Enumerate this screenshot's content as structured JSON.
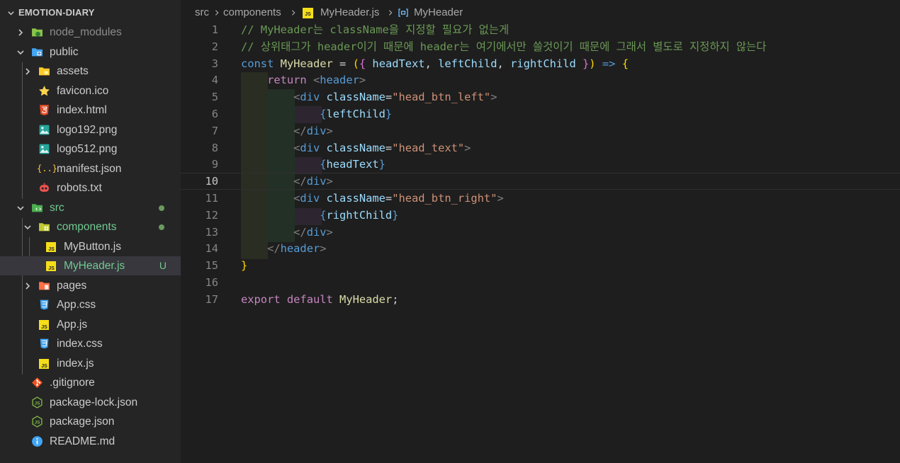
{
  "explorer": {
    "title": "EMOTION-DIARY",
    "items": [
      {
        "label": "node_modules",
        "icon": "folder-node-icon",
        "badge": ""
      },
      {
        "label": "public",
        "icon": "folder-public-icon",
        "badge": ""
      },
      {
        "label": "assets",
        "icon": "folder-assets-icon",
        "badge": ""
      },
      {
        "label": "favicon.ico",
        "icon": "star-icon",
        "badge": ""
      },
      {
        "label": "index.html",
        "icon": "html5-icon",
        "badge": ""
      },
      {
        "label": "logo192.png",
        "icon": "image-icon",
        "badge": ""
      },
      {
        "label": "logo512.png",
        "icon": "image-icon",
        "badge": ""
      },
      {
        "label": "manifest.json",
        "icon": "json-braces-icon",
        "badge": ""
      },
      {
        "label": "robots.txt",
        "icon": "robot-icon",
        "badge": ""
      },
      {
        "label": "src",
        "icon": "folder-src-icon",
        "badge": ""
      },
      {
        "label": "components",
        "icon": "folder-components-icon",
        "badge": ""
      },
      {
        "label": "MyButton.js",
        "icon": "js-file-icon",
        "badge": ""
      },
      {
        "label": "MyHeader.js",
        "icon": "js-file-icon",
        "badge": "U"
      },
      {
        "label": "pages",
        "icon": "folder-pages-icon",
        "badge": ""
      },
      {
        "label": "App.css",
        "icon": "css3-icon",
        "badge": ""
      },
      {
        "label": "App.js",
        "icon": "js-file-icon",
        "badge": ""
      },
      {
        "label": "index.css",
        "icon": "css3-icon",
        "badge": ""
      },
      {
        "label": "index.js",
        "icon": "js-file-icon",
        "badge": ""
      },
      {
        "label": ".gitignore",
        "icon": "git-icon",
        "badge": ""
      },
      {
        "label": "package-lock.json",
        "icon": "nodejs-icon",
        "badge": ""
      },
      {
        "label": "package.json",
        "icon": "nodejs-icon",
        "badge": ""
      },
      {
        "label": "README.md",
        "icon": "info-icon",
        "badge": ""
      }
    ]
  },
  "breadcrumb": {
    "folder1": "src",
    "folder2": "components",
    "file_badge": "JS",
    "file": "MyHeader.js",
    "symbol": "MyHeader"
  },
  "editor": {
    "lines": [
      {
        "n": "1",
        "tokens": [
          [
            "c-com",
            "// MyHeader는 className을 지정할 필요가 없는게"
          ]
        ]
      },
      {
        "n": "2",
        "tokens": [
          [
            "c-com",
            "// 상위태그가 header이기 때문에 header는 여기에서만 쓸것이기 때문에 그래서 별도로 지정하지 않는다"
          ]
        ]
      },
      {
        "n": "3",
        "tokens": [
          [
            "c-kw",
            "const"
          ],
          [
            "c-p",
            " "
          ],
          [
            "c-fn",
            "MyHeader"
          ],
          [
            "c-p",
            " = "
          ],
          [
            "c-g1",
            "("
          ],
          [
            "c-g2",
            "{"
          ],
          [
            "c-p",
            " "
          ],
          [
            "c-var",
            "headText"
          ],
          [
            "c-p",
            ", "
          ],
          [
            "c-var",
            "leftChild"
          ],
          [
            "c-p",
            ", "
          ],
          [
            "c-var",
            "rightChild"
          ],
          [
            "c-p",
            " "
          ],
          [
            "c-g2",
            "}"
          ],
          [
            "c-g1",
            ")"
          ],
          [
            "c-p",
            " "
          ],
          [
            "c-kw",
            "=>"
          ],
          [
            "c-p",
            " "
          ],
          [
            "c-g1",
            "{"
          ]
        ]
      },
      {
        "n": "4",
        "tokens": [
          [
            "c-p",
            "    "
          ],
          [
            "c-ctl",
            "return"
          ],
          [
            "c-p",
            " "
          ],
          [
            "c-brk",
            "<"
          ],
          [
            "c-tag",
            "header"
          ],
          [
            "c-brk",
            ">"
          ]
        ]
      },
      {
        "n": "5",
        "tokens": [
          [
            "c-p",
            "        "
          ],
          [
            "c-brk",
            "<"
          ],
          [
            "c-tag",
            "div"
          ],
          [
            "c-p",
            " "
          ],
          [
            "c-attr",
            "className"
          ],
          [
            "c-p",
            "="
          ],
          [
            "c-str",
            "\"head_btn_left\""
          ],
          [
            "c-brk",
            ">"
          ]
        ]
      },
      {
        "n": "6",
        "tokens": [
          [
            "c-p",
            "            "
          ],
          [
            "c-kw",
            "{"
          ],
          [
            "c-var",
            "leftChild"
          ],
          [
            "c-kw",
            "}"
          ]
        ]
      },
      {
        "n": "7",
        "tokens": [
          [
            "c-p",
            "        "
          ],
          [
            "c-brk",
            "</"
          ],
          [
            "c-tag",
            "div"
          ],
          [
            "c-brk",
            ">"
          ]
        ]
      },
      {
        "n": "8",
        "tokens": [
          [
            "c-p",
            "        "
          ],
          [
            "c-brk",
            "<"
          ],
          [
            "c-tag",
            "div"
          ],
          [
            "c-p",
            " "
          ],
          [
            "c-attr",
            "className"
          ],
          [
            "c-p",
            "="
          ],
          [
            "c-str",
            "\"head_text\""
          ],
          [
            "c-brk",
            ">"
          ]
        ]
      },
      {
        "n": "9",
        "tokens": [
          [
            "c-p",
            "            "
          ],
          [
            "c-kw",
            "{"
          ],
          [
            "c-var",
            "headText"
          ],
          [
            "c-kw",
            "}"
          ]
        ]
      },
      {
        "n": "10",
        "tokens": [
          [
            "c-p",
            "        "
          ],
          [
            "c-brk",
            "</"
          ],
          [
            "c-tag",
            "div"
          ],
          [
            "c-brk",
            ">"
          ]
        ]
      },
      {
        "n": "11",
        "tokens": [
          [
            "c-p",
            "        "
          ],
          [
            "c-brk",
            "<"
          ],
          [
            "c-tag",
            "div"
          ],
          [
            "c-p",
            " "
          ],
          [
            "c-attr",
            "className"
          ],
          [
            "c-p",
            "="
          ],
          [
            "c-str",
            "\"head_btn_right\""
          ],
          [
            "c-brk",
            ">"
          ]
        ]
      },
      {
        "n": "12",
        "tokens": [
          [
            "c-p",
            "            "
          ],
          [
            "c-kw",
            "{"
          ],
          [
            "c-var",
            "rightChild"
          ],
          [
            "c-kw",
            "}"
          ]
        ]
      },
      {
        "n": "13",
        "tokens": [
          [
            "c-p",
            "        "
          ],
          [
            "c-brk",
            "</"
          ],
          [
            "c-tag",
            "div"
          ],
          [
            "c-brk",
            ">"
          ]
        ]
      },
      {
        "n": "14",
        "tokens": [
          [
            "c-p",
            "    "
          ],
          [
            "c-brk",
            "</"
          ],
          [
            "c-tag",
            "header"
          ],
          [
            "c-brk",
            ">"
          ]
        ]
      },
      {
        "n": "15",
        "tokens": [
          [
            "c-g1",
            "}"
          ]
        ]
      },
      {
        "n": "16",
        "tokens": []
      },
      {
        "n": "17",
        "tokens": [
          [
            "c-ctl",
            "export"
          ],
          [
            "c-p",
            " "
          ],
          [
            "c-ctl",
            "default"
          ],
          [
            "c-p",
            " "
          ],
          [
            "c-fn",
            "MyHeader"
          ],
          [
            "c-p",
            ";"
          ]
        ]
      }
    ]
  },
  "colors": {
    "editor_bg": "#1e1e1e",
    "sidebar_bg": "#252526",
    "selection_bg": "#37373d",
    "untracked_green": "#73c991"
  }
}
